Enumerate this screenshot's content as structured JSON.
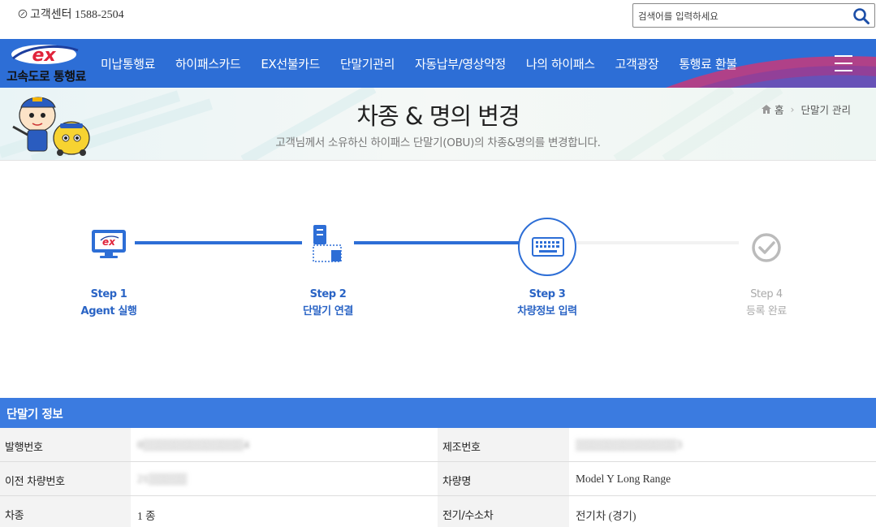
{
  "topbar": {
    "customer_center": "고객센터 1588-2504",
    "search_placeholder": "검색어를 입력하세요"
  },
  "gnb": {
    "logo_text": "고속도로 통행료",
    "logo_mark": "ex",
    "menu": [
      "미납통행료",
      "하이패스카드",
      "EX선불카드",
      "단말기관리",
      "자동납부/영상약정",
      "나의 하이패스",
      "고객광장",
      "통행료 환불"
    ]
  },
  "banner": {
    "title": "차종 & 명의 변경",
    "subtitle": "고객님께서 소유하신 하이패스 단말기(OBU)의 차종&명의를 변경합니다.",
    "breadcrumb_home": "홈",
    "breadcrumb_current": "단말기 관리"
  },
  "steps": [
    {
      "step": "Step 1",
      "label": "Agent 실행",
      "status": "done",
      "icon": "monitor-icon"
    },
    {
      "step": "Step 2",
      "label": "단말기 연결",
      "status": "done",
      "icon": "device-connect-icon"
    },
    {
      "step": "Step 3",
      "label": "차량정보 입력",
      "status": "current",
      "icon": "keyboard-icon"
    },
    {
      "step": "Step 4",
      "label": "등록 완료",
      "status": "pending",
      "icon": "check-circle-icon"
    }
  ],
  "info": {
    "title": "단말기 정보",
    "rows": [
      {
        "h1": "발행번호",
        "v1": "0▒▒▒▒▒▒▒▒▒▒▒▒▒4",
        "h2": "제조번호",
        "v2": "▒▒▒▒▒▒▒▒▒▒▒▒▒3"
      },
      {
        "h1": "이전 차량번호",
        "v1": "21▒▒▒▒▒",
        "h2": "차량명",
        "v2": "Model Y Long Range"
      },
      {
        "h1": "차종",
        "v1": "1  종",
        "h2": "전기/수소차",
        "v2": "전기차 (경기)"
      }
    ]
  },
  "colors": {
    "brand_blue": "#2d6ed6",
    "step_active": "#2a64c5",
    "step_inactive": "#bbbbbb",
    "table_header": "#3b7be0"
  }
}
